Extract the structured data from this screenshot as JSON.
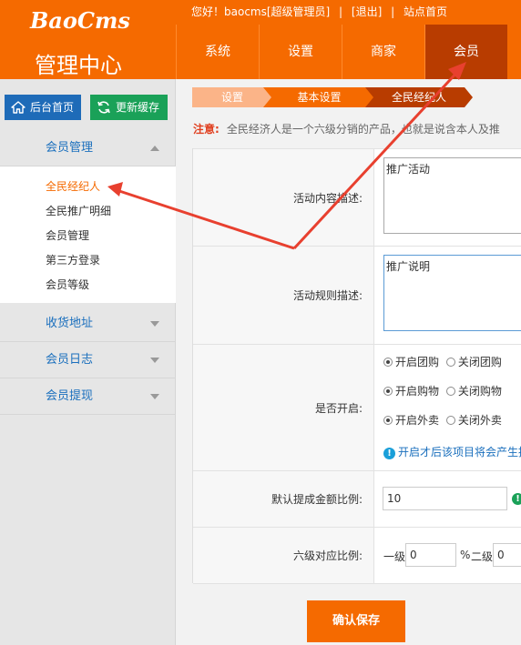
{
  "header": {
    "logo": "BaoCms",
    "subtitle": "管理中心",
    "topbar": {
      "greeting": "您好！baocms[超级管理员]",
      "logout": "[退出]",
      "home_link": "站点首页"
    },
    "tabs": [
      {
        "label": "系统"
      },
      {
        "label": "设置"
      },
      {
        "label": "商家"
      },
      {
        "label": "会员",
        "active": true
      }
    ]
  },
  "sidebar": {
    "home_button": "后台首页",
    "cache_button": "更新缓存",
    "sections": [
      {
        "label": "会员管理",
        "expanded": true
      },
      {
        "label": "收货地址",
        "expanded": false
      },
      {
        "label": "会员日志",
        "expanded": false
      },
      {
        "label": "会员提现",
        "expanded": false
      }
    ],
    "items": [
      {
        "label": "全民经纪人",
        "active": true
      },
      {
        "label": "全民推广明细"
      },
      {
        "label": "会员管理"
      },
      {
        "label": "第三方登录"
      },
      {
        "label": "会员等级"
      }
    ]
  },
  "breadcrumb": [
    "设置",
    "基本设置",
    "全民经纪人"
  ],
  "notice": {
    "label": "注意:",
    "text": "全民经济人是一个六级分销的产品，也就是说含本人及推"
  },
  "form": {
    "activity_desc": {
      "label": "活动内容描述:",
      "value": "推广活动"
    },
    "rules_desc": {
      "label": "活动规则描述:",
      "value": "推广说明"
    },
    "enable": {
      "label": "是否开启:",
      "options": [
        {
          "on": "开启团购",
          "off": "关闭团购"
        },
        {
          "on": "开启购物",
          "off": "关闭购物"
        },
        {
          "on": "开启外卖",
          "off": "关闭外卖"
        }
      ],
      "hint": "开启才后该项目将会产生推"
    },
    "withdraw_ratio": {
      "label": "默认提成金额比例:",
      "value": "10"
    },
    "level_ratio": {
      "label": "六级对应比例:",
      "level1_label": "一级",
      "level1_value": "0",
      "percent": "%",
      "level2_label": "二级",
      "level2_value": "0"
    }
  },
  "save_button": "确认保存",
  "colors": {
    "brand": "#f56a00",
    "nav_active": "#b83c00",
    "link_blue": "#1a6fbd",
    "annotation_red": "#e8402f"
  }
}
